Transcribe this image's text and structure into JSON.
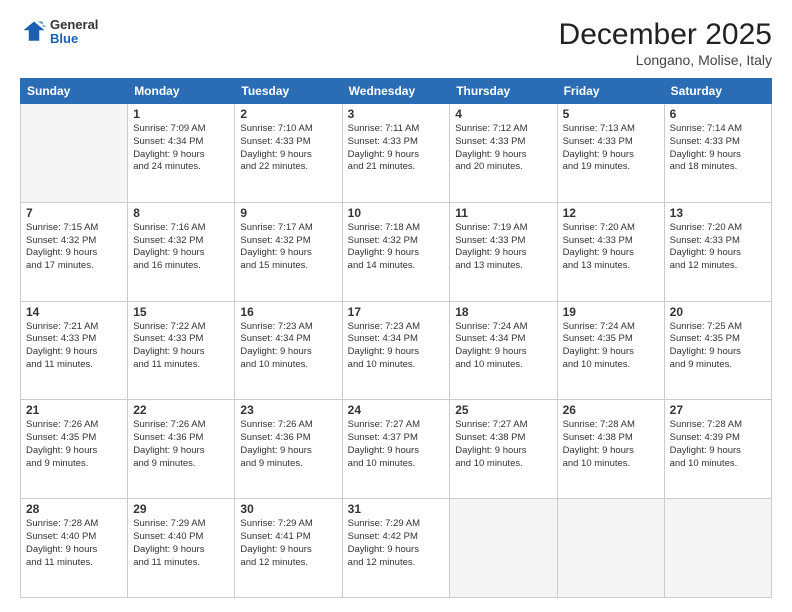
{
  "logo": {
    "general": "General",
    "blue": "Blue"
  },
  "header": {
    "month": "December 2025",
    "location": "Longano, Molise, Italy"
  },
  "days_of_week": [
    "Sunday",
    "Monday",
    "Tuesday",
    "Wednesday",
    "Thursday",
    "Friday",
    "Saturday"
  ],
  "weeks": [
    [
      {
        "day": "",
        "info": ""
      },
      {
        "day": "1",
        "info": "Sunrise: 7:09 AM\nSunset: 4:34 PM\nDaylight: 9 hours\nand 24 minutes."
      },
      {
        "day": "2",
        "info": "Sunrise: 7:10 AM\nSunset: 4:33 PM\nDaylight: 9 hours\nand 22 minutes."
      },
      {
        "day": "3",
        "info": "Sunrise: 7:11 AM\nSunset: 4:33 PM\nDaylight: 9 hours\nand 21 minutes."
      },
      {
        "day": "4",
        "info": "Sunrise: 7:12 AM\nSunset: 4:33 PM\nDaylight: 9 hours\nand 20 minutes."
      },
      {
        "day": "5",
        "info": "Sunrise: 7:13 AM\nSunset: 4:33 PM\nDaylight: 9 hours\nand 19 minutes."
      },
      {
        "day": "6",
        "info": "Sunrise: 7:14 AM\nSunset: 4:33 PM\nDaylight: 9 hours\nand 18 minutes."
      }
    ],
    [
      {
        "day": "7",
        "info": "Sunrise: 7:15 AM\nSunset: 4:32 PM\nDaylight: 9 hours\nand 17 minutes."
      },
      {
        "day": "8",
        "info": "Sunrise: 7:16 AM\nSunset: 4:32 PM\nDaylight: 9 hours\nand 16 minutes."
      },
      {
        "day": "9",
        "info": "Sunrise: 7:17 AM\nSunset: 4:32 PM\nDaylight: 9 hours\nand 15 minutes."
      },
      {
        "day": "10",
        "info": "Sunrise: 7:18 AM\nSunset: 4:32 PM\nDaylight: 9 hours\nand 14 minutes."
      },
      {
        "day": "11",
        "info": "Sunrise: 7:19 AM\nSunset: 4:33 PM\nDaylight: 9 hours\nand 13 minutes."
      },
      {
        "day": "12",
        "info": "Sunrise: 7:20 AM\nSunset: 4:33 PM\nDaylight: 9 hours\nand 13 minutes."
      },
      {
        "day": "13",
        "info": "Sunrise: 7:20 AM\nSunset: 4:33 PM\nDaylight: 9 hours\nand 12 minutes."
      }
    ],
    [
      {
        "day": "14",
        "info": "Sunrise: 7:21 AM\nSunset: 4:33 PM\nDaylight: 9 hours\nand 11 minutes."
      },
      {
        "day": "15",
        "info": "Sunrise: 7:22 AM\nSunset: 4:33 PM\nDaylight: 9 hours\nand 11 minutes."
      },
      {
        "day": "16",
        "info": "Sunrise: 7:23 AM\nSunset: 4:34 PM\nDaylight: 9 hours\nand 10 minutes."
      },
      {
        "day": "17",
        "info": "Sunrise: 7:23 AM\nSunset: 4:34 PM\nDaylight: 9 hours\nand 10 minutes."
      },
      {
        "day": "18",
        "info": "Sunrise: 7:24 AM\nSunset: 4:34 PM\nDaylight: 9 hours\nand 10 minutes."
      },
      {
        "day": "19",
        "info": "Sunrise: 7:24 AM\nSunset: 4:35 PM\nDaylight: 9 hours\nand 10 minutes."
      },
      {
        "day": "20",
        "info": "Sunrise: 7:25 AM\nSunset: 4:35 PM\nDaylight: 9 hours\nand 9 minutes."
      }
    ],
    [
      {
        "day": "21",
        "info": "Sunrise: 7:26 AM\nSunset: 4:35 PM\nDaylight: 9 hours\nand 9 minutes."
      },
      {
        "day": "22",
        "info": "Sunrise: 7:26 AM\nSunset: 4:36 PM\nDaylight: 9 hours\nand 9 minutes."
      },
      {
        "day": "23",
        "info": "Sunrise: 7:26 AM\nSunset: 4:36 PM\nDaylight: 9 hours\nand 9 minutes."
      },
      {
        "day": "24",
        "info": "Sunrise: 7:27 AM\nSunset: 4:37 PM\nDaylight: 9 hours\nand 10 minutes."
      },
      {
        "day": "25",
        "info": "Sunrise: 7:27 AM\nSunset: 4:38 PM\nDaylight: 9 hours\nand 10 minutes."
      },
      {
        "day": "26",
        "info": "Sunrise: 7:28 AM\nSunset: 4:38 PM\nDaylight: 9 hours\nand 10 minutes."
      },
      {
        "day": "27",
        "info": "Sunrise: 7:28 AM\nSunset: 4:39 PM\nDaylight: 9 hours\nand 10 minutes."
      }
    ],
    [
      {
        "day": "28",
        "info": "Sunrise: 7:28 AM\nSunset: 4:40 PM\nDaylight: 9 hours\nand 11 minutes."
      },
      {
        "day": "29",
        "info": "Sunrise: 7:29 AM\nSunset: 4:40 PM\nDaylight: 9 hours\nand 11 minutes."
      },
      {
        "day": "30",
        "info": "Sunrise: 7:29 AM\nSunset: 4:41 PM\nDaylight: 9 hours\nand 12 minutes."
      },
      {
        "day": "31",
        "info": "Sunrise: 7:29 AM\nSunset: 4:42 PM\nDaylight: 9 hours\nand 12 minutes."
      },
      {
        "day": "",
        "info": ""
      },
      {
        "day": "",
        "info": ""
      },
      {
        "day": "",
        "info": ""
      }
    ]
  ]
}
